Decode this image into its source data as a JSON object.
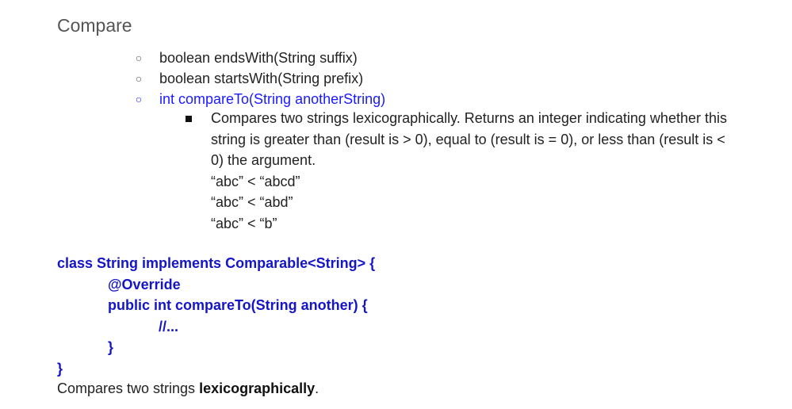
{
  "heading": "Compare",
  "methods": [
    {
      "label": "boolean endsWith(String suffix)"
    },
    {
      "label": "boolean startsWith(String prefix)"
    },
    {
      "label": "int compareTo(String anotherString)"
    }
  ],
  "compare_to": {
    "description": "Compares two strings lexicographically. Returns an integer indicating whether this string is greater than (result is > 0), equal to (result is = 0), or less than (result is < 0) the argument.",
    "examples": [
      "“abc” < “abcd”",
      "“abc” < “abd”",
      "“abc” < “b”"
    ]
  },
  "code": {
    "line1": "class String implements Comparable<String> {",
    "line2": "@Override",
    "line3": "public int compareTo(String another) {",
    "line4": "//...",
    "line5": "}",
    "line6": "}"
  },
  "footer": {
    "prefix": "Compares two strings ",
    "bold": "lexicographically",
    "suffix": "."
  },
  "colors": {
    "link": "#1a1aff",
    "code": "#1414c8",
    "text": "#222222"
  }
}
